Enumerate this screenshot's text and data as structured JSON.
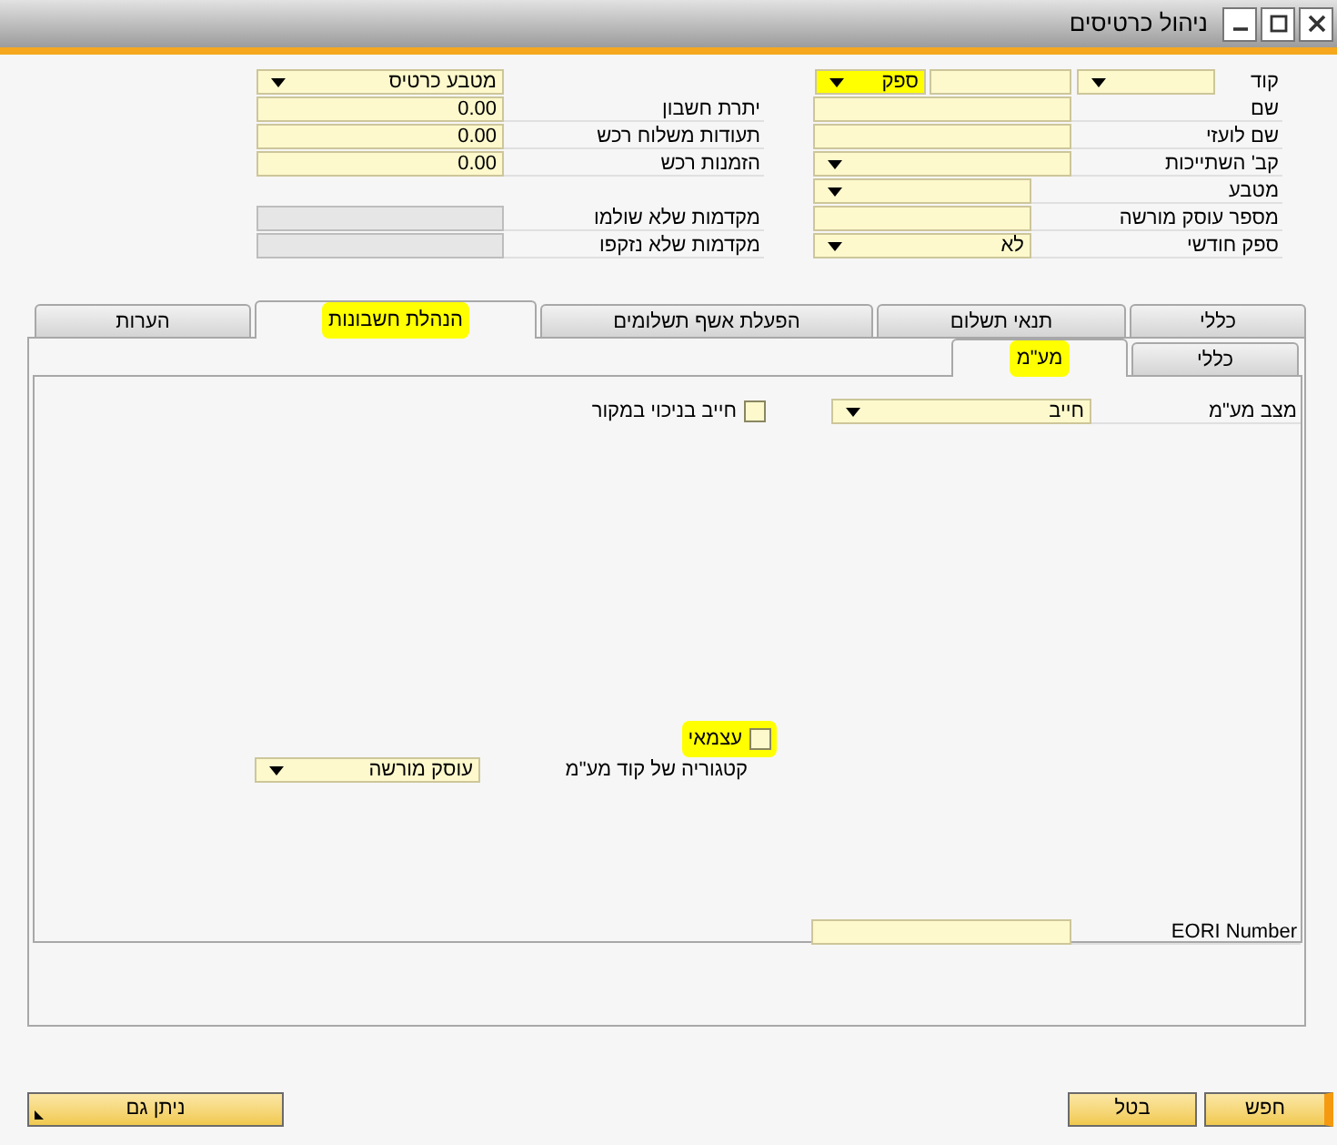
{
  "window": {
    "title": "ניהול כרטיסים"
  },
  "header": {
    "code": {
      "label": "קוד",
      "card_type": {
        "value": "ספק",
        "highlighted": true
      }
    },
    "fields": [
      {
        "label": "שם",
        "kind": "text"
      },
      {
        "label": "שם לועזי",
        "kind": "text"
      },
      {
        "label": "קב' השתייכות",
        "kind": "dropdown"
      },
      {
        "label": "מטבע",
        "kind": "dropdown"
      },
      {
        "label": "מספר עוסק מורשה",
        "kind": "text"
      },
      {
        "label": "ספק חודשי",
        "kind": "dropdown",
        "value": "לא"
      }
    ],
    "currency": {
      "value": "מטבע כרטיס"
    },
    "balances": [
      {
        "label": "יתרת חשבון",
        "value": "0.00"
      },
      {
        "label": "תעודות משלוח רכש",
        "value": "0.00"
      },
      {
        "label": "הזמנות רכש",
        "value": "0.00"
      }
    ],
    "down_payments": [
      {
        "label": "מקדמות שלא שולמו"
      },
      {
        "label": "מקדמות שלא נזקפו"
      }
    ]
  },
  "tabs": [
    {
      "label": "כללי",
      "selected": false,
      "highlighted": false
    },
    {
      "label": "תנאי תשלום",
      "selected": false,
      "highlighted": false
    },
    {
      "label": "הפעלת אשף תשלומים",
      "selected": false,
      "highlighted": false
    },
    {
      "label": "הנהלת חשבונות",
      "selected": true,
      "highlighted": true
    },
    {
      "label": "הערות",
      "selected": false,
      "highlighted": false
    }
  ],
  "subtabs": [
    {
      "label": "כללי",
      "selected": false,
      "highlighted": false
    },
    {
      "label": "מע\"מ",
      "selected": true,
      "highlighted": true
    }
  ],
  "vat": {
    "status": {
      "label": "מצב מע\"מ",
      "value": "חייב"
    },
    "withholding": {
      "label": "חייב בניכוי במקור",
      "checked": false,
      "highlighted": false
    },
    "self_employed": {
      "label": "עצמאי",
      "checked": false,
      "highlighted": true
    },
    "category": {
      "label": "קטגוריה של קוד מע\"מ",
      "value": "עוסק מורשה"
    },
    "eori": {
      "label": "EORI Number"
    }
  },
  "buttons": [
    {
      "label": "חפש",
      "kind": "primary"
    },
    {
      "label": "בטל",
      "kind": "normal"
    }
  ],
  "also_button": {
    "label": "ניתן גם"
  }
}
